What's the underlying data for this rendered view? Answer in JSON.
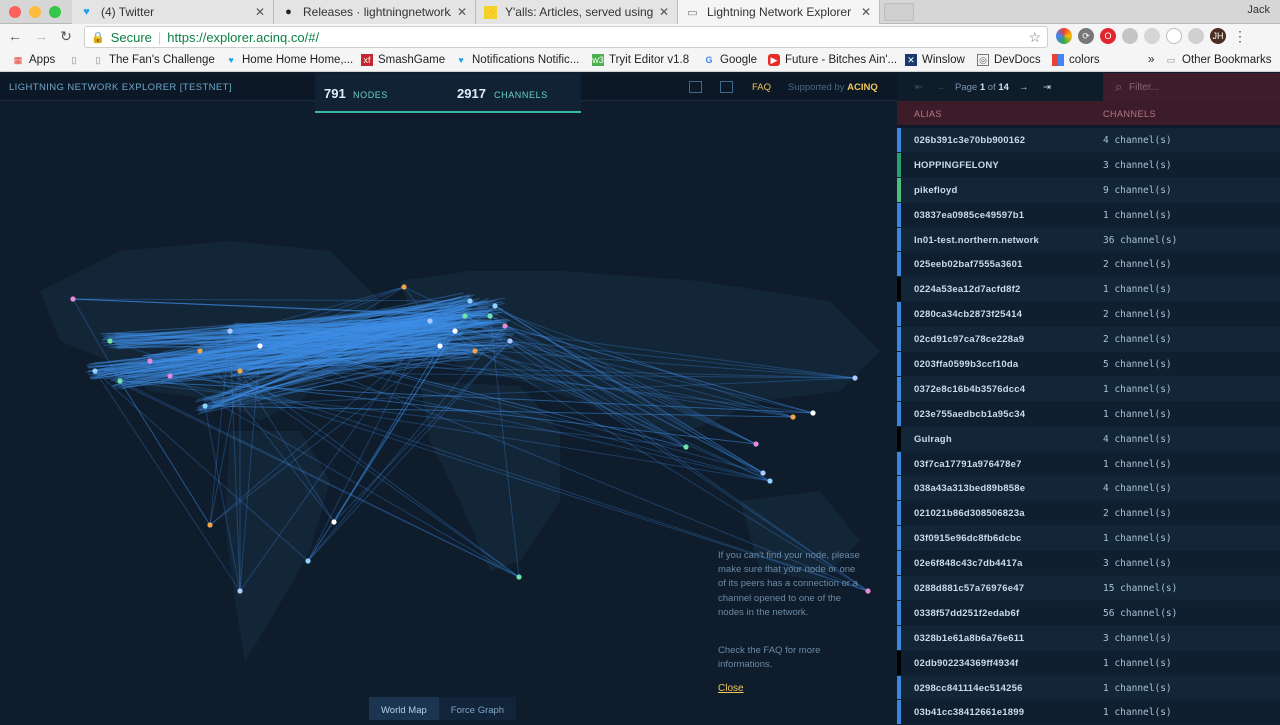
{
  "browser": {
    "tabs": [
      {
        "label": "(4) Twitter",
        "icon": "twitter-icon"
      },
      {
        "label": "Releases · lightningnetwork/lnd",
        "icon": "github-icon"
      },
      {
        "label": "Y'alls: Articles, served using the",
        "icon": "lightning-icon"
      },
      {
        "label": "Lightning Network Explorer (TE",
        "icon": "document-icon"
      }
    ],
    "user": "Jack",
    "secure_label": "Secure",
    "url": "https://explorer.acinq.co/#/",
    "bookmarks": [
      {
        "label": "Apps"
      },
      {
        "label": ""
      },
      {
        "label": "The Fan's Challenge"
      },
      {
        "label": "Home Home Home,..."
      },
      {
        "label": "SmashGame"
      },
      {
        "label": "Notifications Notific..."
      },
      {
        "label": "Tryit Editor v1.8"
      },
      {
        "label": "Google"
      },
      {
        "label": "Future - Bitches Ain'..."
      },
      {
        "label": "Winslow"
      },
      {
        "label": "DevDocs"
      },
      {
        "label": "colors"
      },
      {
        "label": "Other Bookmarks"
      }
    ]
  },
  "explorer": {
    "brand": "LIGHTNING NETWORK EXPLORER [TESTNET]",
    "nodes_count": "791",
    "nodes_label": "NODES",
    "channels_count": "2917",
    "channels_label": "CHANNELS",
    "faq_label": "FAQ",
    "supported_by": "Supported by",
    "supporter": "ACINQ",
    "pager": {
      "page_prefix": "Page",
      "page": "1",
      "of": "of",
      "total": "14"
    },
    "filter_placeholder": "Filter...",
    "table": {
      "headers": {
        "alias": "ALIAS",
        "channels": "CHANNELS"
      },
      "rows": [
        {
          "alias": "026b391c3e70bb900162",
          "channels": "4 channel(s)",
          "color": "#3a86e0"
        },
        {
          "alias": "HOPPINGFELONY",
          "channels": "3 channel(s)",
          "color": "#2aa06a"
        },
        {
          "alias": "pikefloyd",
          "channels": "9 channel(s)",
          "color": "#48c17c"
        },
        {
          "alias": "03837ea0985ce49597b1",
          "channels": "1 channel(s)",
          "color": "#3a86e0"
        },
        {
          "alias": "ln01-test.northern.network",
          "channels": "36 channel(s)",
          "color": "#3a86e0"
        },
        {
          "alias": "025eeb02baf7555a3601",
          "channels": "2 channel(s)",
          "color": "#3a86e0"
        },
        {
          "alias": "0224a53ea12d7acfd8f2",
          "channels": "1 channel(s)",
          "color": "#000000"
        },
        {
          "alias": "0280ca34cb2873f25414",
          "channels": "2 channel(s)",
          "color": "#3a86e0"
        },
        {
          "alias": "02cd91c97ca78ce228a9",
          "channels": "2 channel(s)",
          "color": "#3a86e0"
        },
        {
          "alias": "0203ffa0599b3ccf10da",
          "channels": "5 channel(s)",
          "color": "#3a86e0"
        },
        {
          "alias": "0372e8c16b4b3576dcc4",
          "channels": "1 channel(s)",
          "color": "#3a86e0"
        },
        {
          "alias": "023e755aedbcb1a95c34",
          "channels": "1 channel(s)",
          "color": "#3a86e0"
        },
        {
          "alias": "Gulragh",
          "channels": "4 channel(s)",
          "color": "#000000"
        },
        {
          "alias": "03f7ca17791a976478e7",
          "channels": "1 channel(s)",
          "color": "#3a86e0"
        },
        {
          "alias": "038a43a313bed89b858e",
          "channels": "4 channel(s)",
          "color": "#3a86e0"
        },
        {
          "alias": "021021b86d308506823a",
          "channels": "2 channel(s)",
          "color": "#3a86e0"
        },
        {
          "alias": "03f0915e96dc8fb6dcbc",
          "channels": "1 channel(s)",
          "color": "#3a86e0"
        },
        {
          "alias": "02e6f848c43c7db4417a",
          "channels": "3 channel(s)",
          "color": "#3a86e0"
        },
        {
          "alias": "0288d881c57a76976e47",
          "channels": "15 channel(s)",
          "color": "#3a86e0"
        },
        {
          "alias": "0338f57dd251f2edab6f",
          "channels": "56 channel(s)",
          "color": "#3a86e0"
        },
        {
          "alias": "0328b1e61a8b6a76e611",
          "channels": "3 channel(s)",
          "color": "#3a86e0"
        },
        {
          "alias": "02db902234369ff4934f",
          "channels": "1 channel(s)",
          "color": "#000000"
        },
        {
          "alias": "0298cc841114ec514256",
          "channels": "1 channel(s)",
          "color": "#3a86e0"
        },
        {
          "alias": "03b41cc38412661e1899",
          "channels": "1 channel(s)",
          "color": "#3a86e0"
        }
      ]
    },
    "note_text": "If you can't find your node, please make sure that your node or one of its peers has a connection or a channel opened to one of the nodes in the network.",
    "note2_prefix": "Check the",
    "note2_link": "FAQ",
    "note2_suffix": "for more informations.",
    "close_label": "Close",
    "view_modes": {
      "world": "World Map",
      "force": "Force Graph"
    },
    "accent_color": "#f0c85b",
    "edge_color": "#3f8fe8"
  }
}
